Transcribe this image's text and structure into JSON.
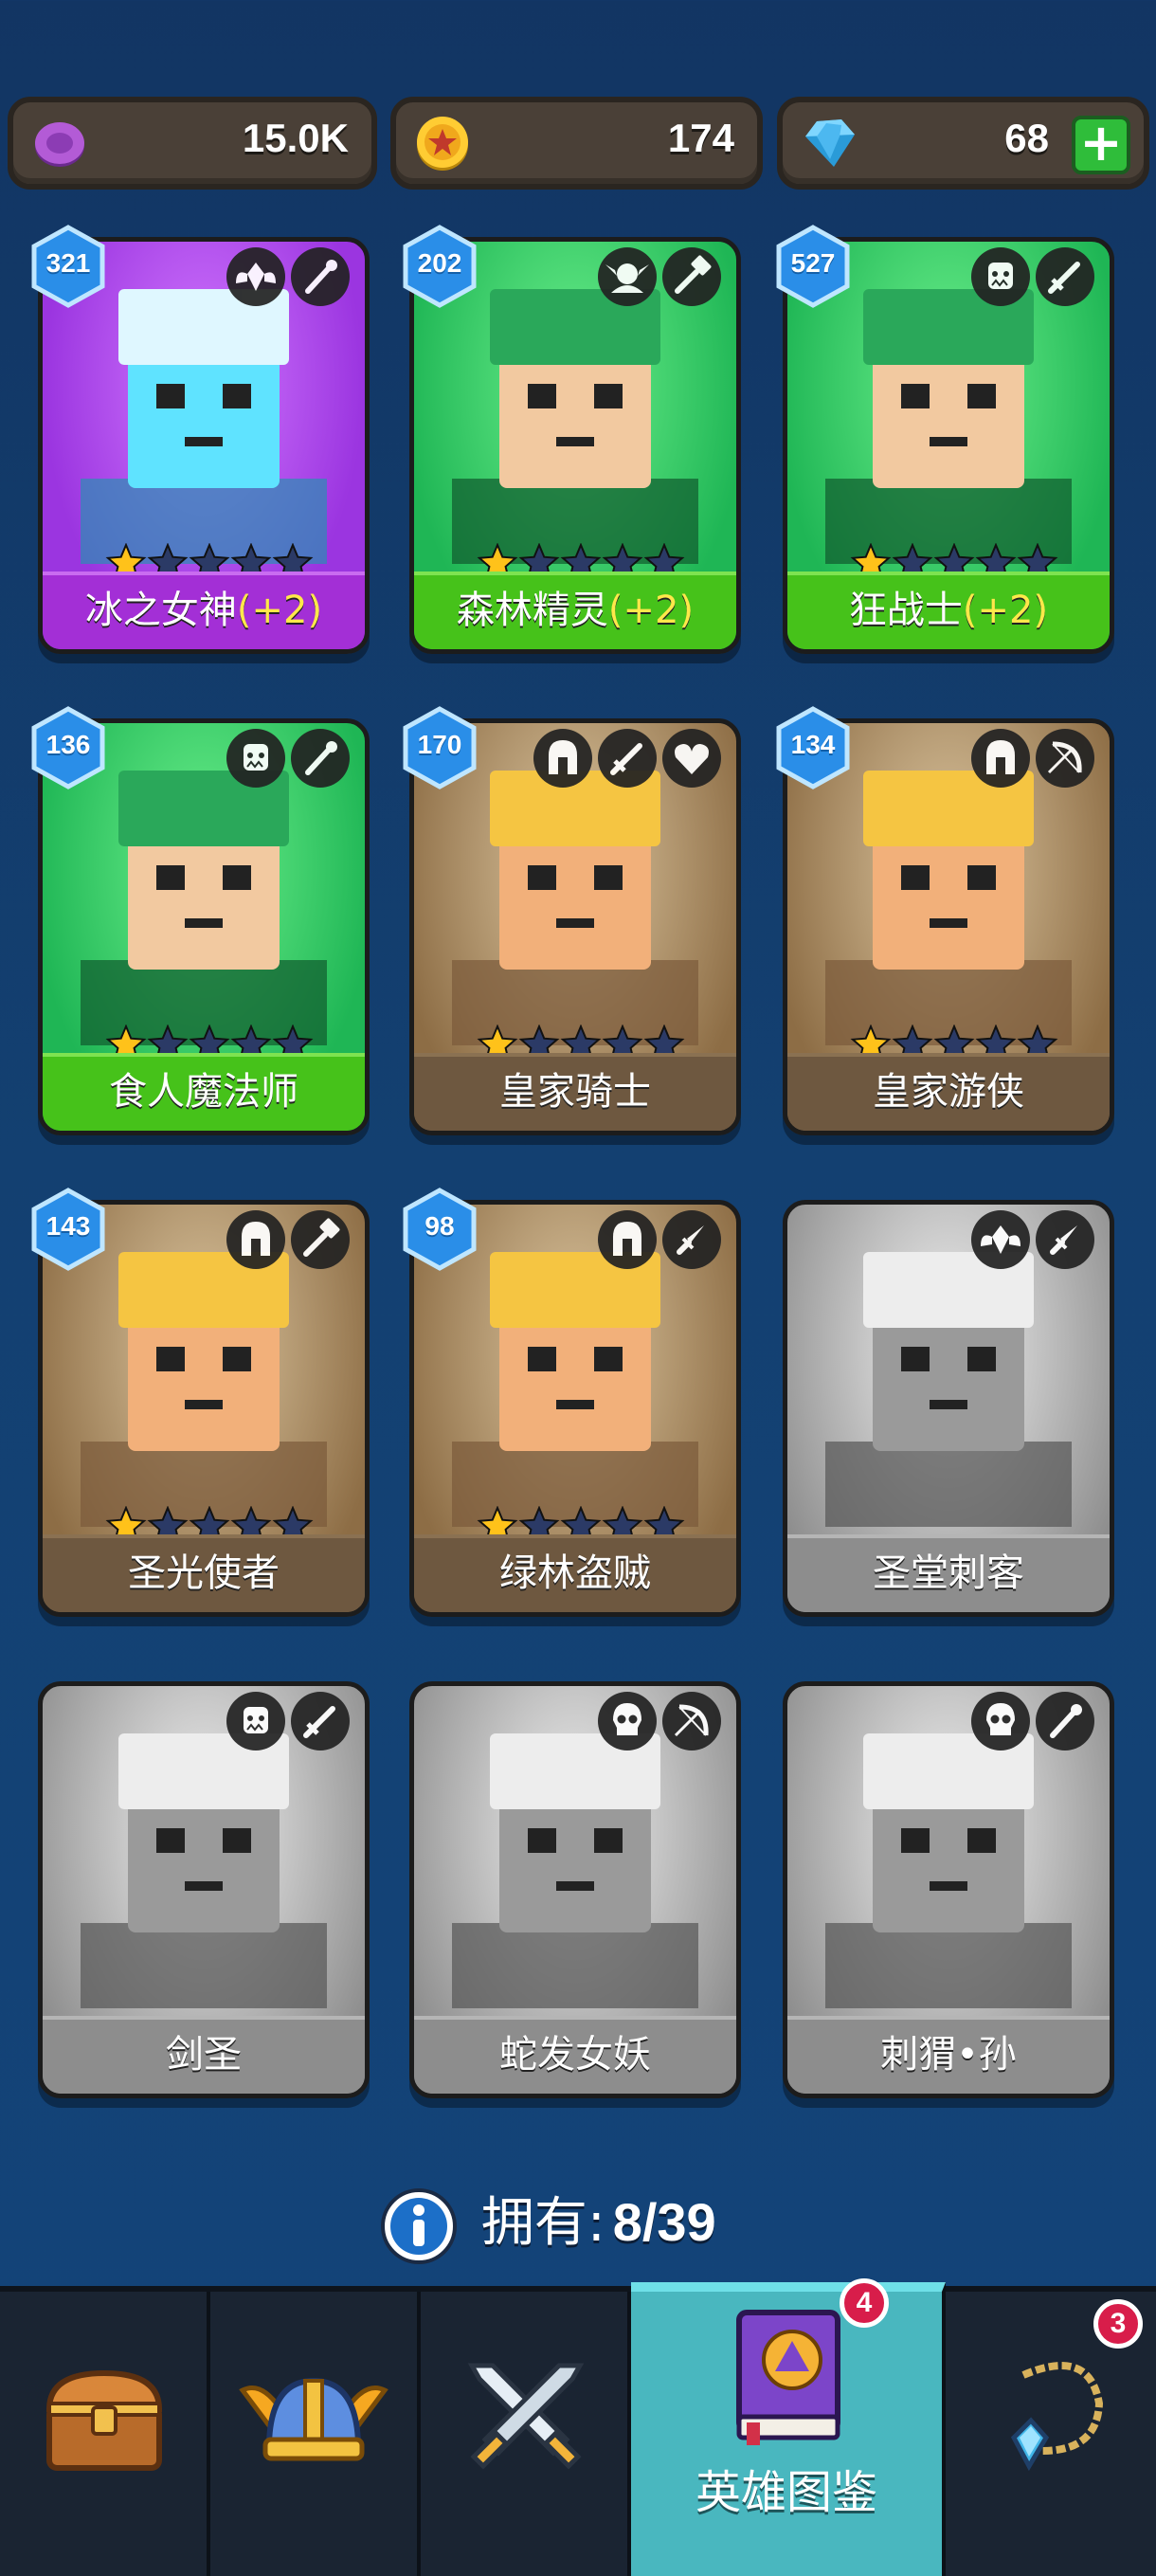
{
  "currencies": [
    {
      "icon": "purple-orb-icon",
      "value": "15.0K"
    },
    {
      "icon": "gold-coin-icon",
      "value": "174"
    },
    {
      "icon": "blue-gem-icon",
      "value": "68",
      "plus": "+"
    }
  ],
  "heroes": [
    {
      "level": "321",
      "name": "冰之女神",
      "bonus": "(+2)",
      "stars": 1,
      "rarity": "purple",
      "owned": true,
      "icons": [
        "winged-emblem-icon",
        "wand-icon"
      ]
    },
    {
      "level": "202",
      "name": "森林精灵",
      "bonus": "(+2)",
      "stars": 1,
      "rarity": "green",
      "owned": true,
      "icons": [
        "elf-emblem-icon",
        "hammer-icon"
      ]
    },
    {
      "level": "527",
      "name": "狂战士",
      "bonus": "(+2)",
      "stars": 1,
      "rarity": "green",
      "owned": true,
      "icons": [
        "orc-emblem-icon",
        "sword-icon"
      ]
    },
    {
      "level": "136",
      "name": "食人魔法师",
      "bonus": "",
      "stars": 1,
      "rarity": "green",
      "owned": true,
      "icons": [
        "orc-emblem-icon",
        "wand-icon"
      ]
    },
    {
      "level": "170",
      "name": "皇家骑士",
      "bonus": "",
      "stars": 1,
      "rarity": "brown",
      "owned": true,
      "icons": [
        "helmet-icon",
        "sword-icon",
        "heart-icon"
      ]
    },
    {
      "level": "134",
      "name": "皇家游侠",
      "bonus": "",
      "stars": 1,
      "rarity": "brown",
      "owned": true,
      "icons": [
        "helmet-icon",
        "bow-icon"
      ]
    },
    {
      "level": "143",
      "name": "圣光使者",
      "bonus": "",
      "stars": 1,
      "rarity": "brown",
      "owned": true,
      "icons": [
        "helmet-icon",
        "hammer-icon"
      ]
    },
    {
      "level": "98",
      "name": "绿林盗贼",
      "bonus": "",
      "stars": 1,
      "rarity": "brown",
      "owned": true,
      "icons": [
        "helmet-icon",
        "dagger-icon"
      ]
    },
    {
      "level": "",
      "name": "圣堂刺客",
      "bonus": "",
      "stars": 0,
      "rarity": "grey",
      "owned": false,
      "icons": [
        "winged-emblem-icon",
        "dagger-icon"
      ]
    },
    {
      "level": "",
      "name": "剑圣",
      "bonus": "",
      "stars": 0,
      "rarity": "grey",
      "owned": false,
      "icons": [
        "orc-emblem-icon",
        "sword-icon"
      ]
    },
    {
      "level": "",
      "name": "蛇发女妖",
      "bonus": "",
      "stars": 0,
      "rarity": "grey",
      "owned": false,
      "icons": [
        "skull-icon",
        "bow-icon"
      ]
    },
    {
      "level": "",
      "name": "刺猬•孙",
      "bonus": "",
      "stars": 0,
      "rarity": "grey",
      "owned": false,
      "icons": [
        "skull-icon",
        "wand-icon"
      ]
    }
  ],
  "ownership": {
    "label": "拥有:",
    "count": "8/39"
  },
  "nav": {
    "tabs": [
      {
        "icon": "treasure-chest-icon",
        "label": ""
      },
      {
        "icon": "viking-helmet-icon",
        "label": ""
      },
      {
        "icon": "crossed-swords-icon",
        "label": ""
      },
      {
        "icon": "hero-book-icon",
        "label": "英雄图鉴",
        "badge": "4",
        "active": true
      },
      {
        "icon": "amulet-icon",
        "label": "",
        "badge": "3"
      }
    ]
  }
}
